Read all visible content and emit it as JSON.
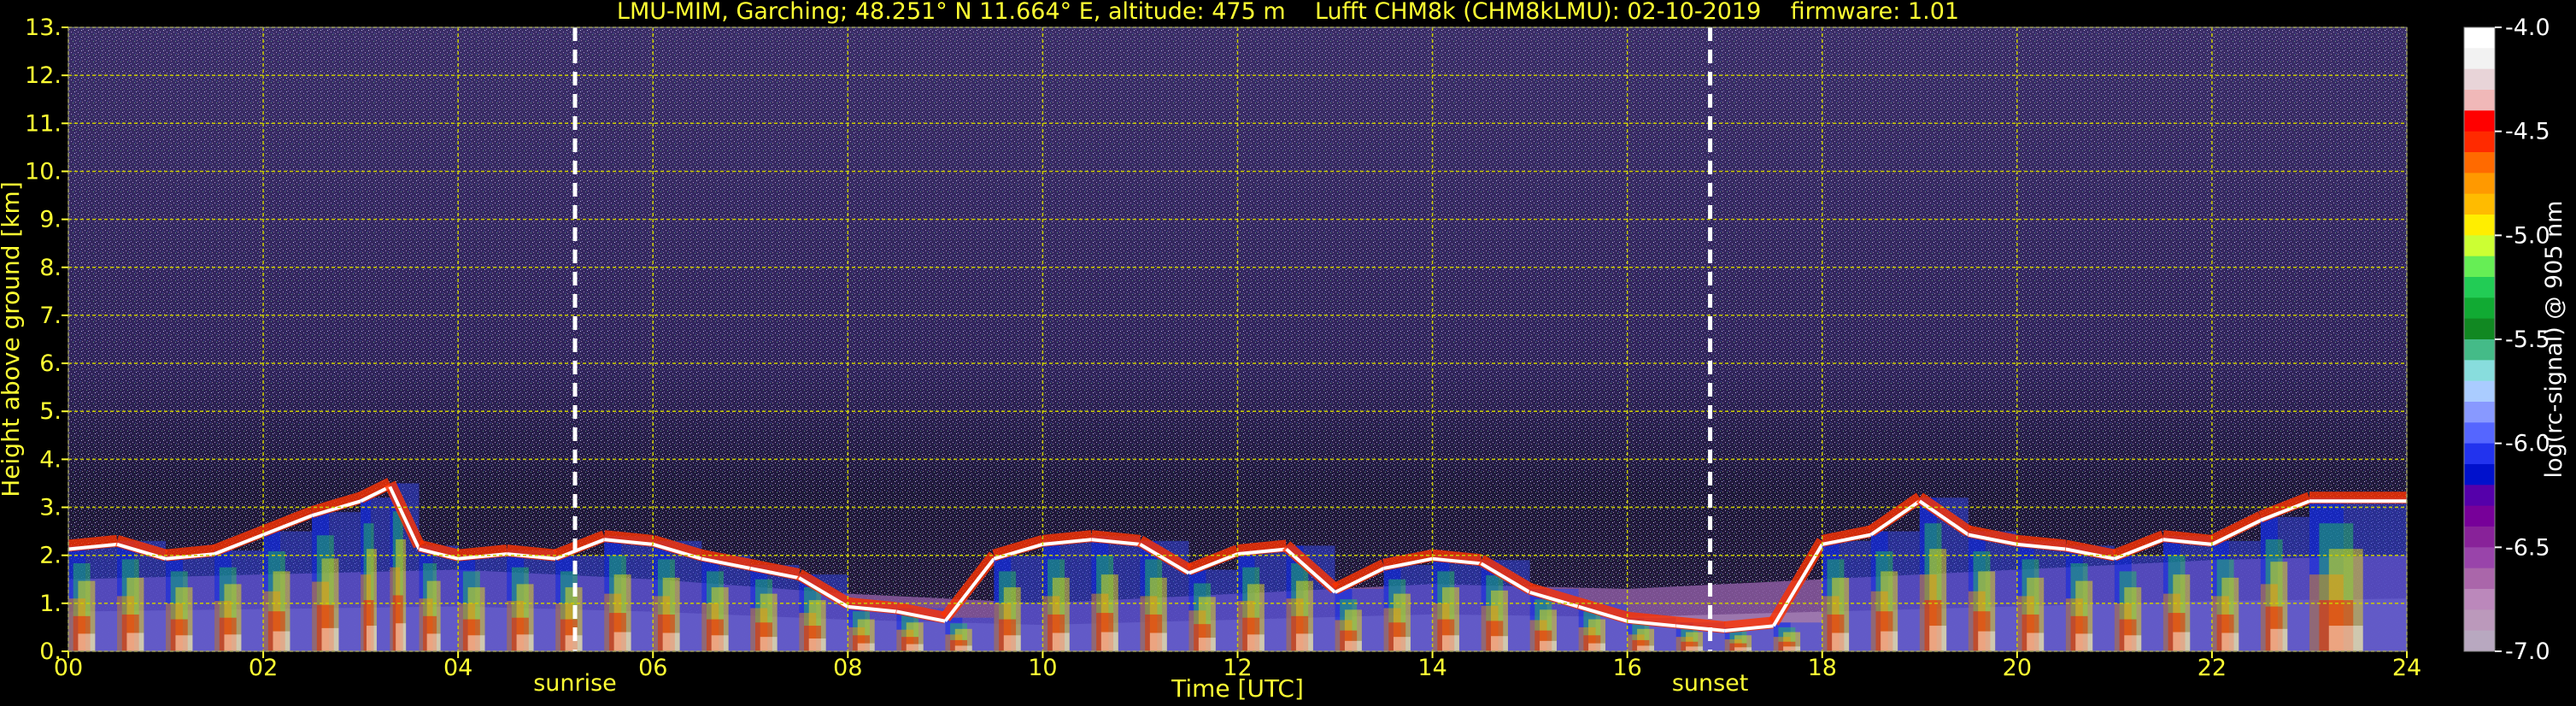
{
  "title": "LMU-MIM, Garching; 48.251° N 11.664° E, altitude: 475 m    Lufft CHM8k (CHM8kLMU): 02-10-2019    firmware: 1.01",
  "colors": {
    "background": "#000000",
    "axis_text": "#ffff33",
    "grid": "#cccc00",
    "marker_line": "#ffffff",
    "colorbar_label": "#ffffff"
  },
  "chart_data": {
    "type": "heatmap",
    "title": "LMU-MIM, Garching; 48.251° N 11.664° E, altitude: 475 m    Lufft CHM8k (CHM8kLMU): 02-10-2019    firmware: 1.01",
    "xlabel": "Time [UTC]",
    "ylabel": "Height above ground [km]",
    "xlim": [
      0,
      24
    ],
    "ylim": [
      0,
      13
    ],
    "x_ticks": [
      0,
      2,
      4,
      6,
      8,
      10,
      12,
      14,
      16,
      18,
      20,
      22,
      24
    ],
    "x_tick_labels": [
      "00",
      "02",
      "04",
      "06",
      "08",
      "10",
      "12",
      "14",
      "16",
      "18",
      "20",
      "22",
      "24"
    ],
    "y_ticks": [
      0,
      1,
      2,
      3,
      4,
      5,
      6,
      7,
      8,
      9,
      10,
      11,
      12,
      13
    ],
    "y_tick_labels": [
      "0.",
      "1.",
      "2.",
      "3.",
      "4.",
      "5.",
      "6.",
      "7.",
      "8.",
      "9.",
      "10.",
      "11.",
      "12.",
      "13."
    ],
    "grid": true,
    "markers": [
      {
        "label": "sunrise",
        "x": 5.2
      },
      {
        "label": "sunset",
        "x": 16.85
      }
    ],
    "colorbar": {
      "label": "log(rc-signal) @ 905 nm",
      "range": [
        -7.0,
        -4.0
      ],
      "ticks": [
        -4.0,
        -4.5,
        -5.0,
        -5.5,
        -6.0,
        -6.5,
        -7.0
      ],
      "tick_labels": [
        "-4.0",
        "-4.5",
        "-5.0",
        "-5.5",
        "-6.0",
        "-6.5",
        "-7.0"
      ],
      "colors_top_to_bottom": [
        "#ffffff",
        "#f2f2f2",
        "#e8d4d8",
        "#f0b8b8",
        "#ff0000",
        "#ff2a00",
        "#ff6a00",
        "#ff9900",
        "#ffbb00",
        "#ffee00",
        "#ccff33",
        "#66ee55",
        "#22cc55",
        "#11aa33",
        "#118822",
        "#44bb88",
        "#88dddd",
        "#aaccff",
        "#8899ff",
        "#5566ff",
        "#2233ee",
        "#0011cc",
        "#5500aa",
        "#770099",
        "#882299",
        "#9944aa",
        "#aa66aa",
        "#bb88bb",
        "#bb99bb",
        "#b8a8c0"
      ]
    },
    "cloud_base_km": [
      [
        0.0,
        2.2
      ],
      [
        0.5,
        2.3
      ],
      [
        1.0,
        2.0
      ],
      [
        1.5,
        2.1
      ],
      [
        2.0,
        2.5
      ],
      [
        2.5,
        2.9
      ],
      [
        3.0,
        3.2
      ],
      [
        3.3,
        3.5
      ],
      [
        3.6,
        2.2
      ],
      [
        4.0,
        2.0
      ],
      [
        4.5,
        2.1
      ],
      [
        5.0,
        2.0
      ],
      [
        5.5,
        2.4
      ],
      [
        6.0,
        2.3
      ],
      [
        6.5,
        2.0
      ],
      [
        7.0,
        1.8
      ],
      [
        7.5,
        1.6
      ],
      [
        8.0,
        1.0
      ],
      [
        8.5,
        0.9
      ],
      [
        9.0,
        0.7
      ],
      [
        9.5,
        2.0
      ],
      [
        10.0,
        2.3
      ],
      [
        10.5,
        2.4
      ],
      [
        11.0,
        2.3
      ],
      [
        11.5,
        1.7
      ],
      [
        12.0,
        2.1
      ],
      [
        12.5,
        2.2
      ],
      [
        13.0,
        1.3
      ],
      [
        13.5,
        1.8
      ],
      [
        14.0,
        2.0
      ],
      [
        14.5,
        1.9
      ],
      [
        15.0,
        1.3
      ],
      [
        15.5,
        1.0
      ],
      [
        16.0,
        0.7
      ],
      [
        16.5,
        0.6
      ],
      [
        17.0,
        0.5
      ],
      [
        17.5,
        0.6
      ],
      [
        18.0,
        2.3
      ],
      [
        18.5,
        2.5
      ],
      [
        19.0,
        3.2
      ],
      [
        19.5,
        2.5
      ],
      [
        20.0,
        2.3
      ],
      [
        20.5,
        2.2
      ],
      [
        21.0,
        2.0
      ],
      [
        21.5,
        2.4
      ],
      [
        22.0,
        2.3
      ],
      [
        22.5,
        2.8
      ],
      [
        23.0,
        3.2
      ]
    ],
    "boundary_layer_top_km": [
      [
        0.0,
        1.5
      ],
      [
        2.0,
        1.6
      ],
      [
        4.0,
        1.7
      ],
      [
        6.0,
        1.5
      ],
      [
        8.0,
        1.2
      ],
      [
        10.0,
        1.0
      ],
      [
        12.0,
        1.2
      ],
      [
        14.0,
        1.4
      ],
      [
        16.0,
        1.3
      ],
      [
        18.0,
        1.5
      ],
      [
        20.0,
        1.7
      ],
      [
        22.0,
        1.9
      ],
      [
        24.0,
        2.0
      ]
    ]
  }
}
